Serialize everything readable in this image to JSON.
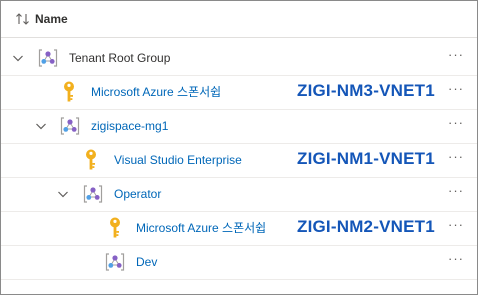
{
  "header": {
    "column_name": "Name",
    "sort_icon": "sort-arrows-icon"
  },
  "rows": [
    {
      "label": "Tenant Root Group",
      "type": "management-group",
      "expanded": true,
      "more": "···"
    },
    {
      "label": "Microsoft Azure 스폰서쉽",
      "type": "subscription",
      "annotation": "ZIGI-NM3-VNET1",
      "more": "···"
    },
    {
      "label": "zigispace-mg1",
      "type": "management-group",
      "expanded": true,
      "more": "···"
    },
    {
      "label": "Visual Studio Enterprise",
      "type": "subscription",
      "annotation": "ZIGI-NM1-VNET1",
      "more": "···"
    },
    {
      "label": "Operator",
      "type": "management-group",
      "expanded": true,
      "more": "···"
    },
    {
      "label": "Microsoft Azure 스폰서쉽",
      "type": "subscription",
      "annotation": "ZIGI-NM2-VNET1",
      "more": "···"
    },
    {
      "label": "Dev",
      "type": "management-group",
      "more": "···"
    }
  ],
  "colors": {
    "link": "#0067b8",
    "annotation": "#1456b8",
    "key_gold": "#f2b01e",
    "mg_purple": "#8661c5",
    "mg_blue": "#50a0e6"
  }
}
